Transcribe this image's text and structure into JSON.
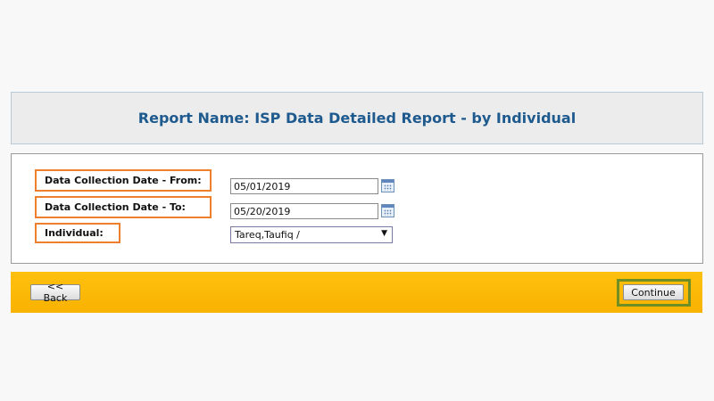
{
  "report": {
    "title": "Report Name: ISP Data Detailed Report - by Individual"
  },
  "form": {
    "date_from_label": "Data Collection Date - From:",
    "date_from_value": "05/01/2019",
    "date_to_label": "Data Collection Date - To:",
    "date_to_value": "05/20/2019",
    "individual_label": "Individual:",
    "individual_value": "Tareq,Taufiq /"
  },
  "actions": {
    "back_label": "<< Back",
    "continue_label": "Continue"
  },
  "colors": {
    "title": "#1e5a8e",
    "label_highlight": "#ee7f2d",
    "continue_highlight": "#6f8f25",
    "action_bar": "#ffc00f"
  },
  "icons": {
    "calendar": "calendar-icon",
    "dropdown": "chevron-down-icon"
  }
}
